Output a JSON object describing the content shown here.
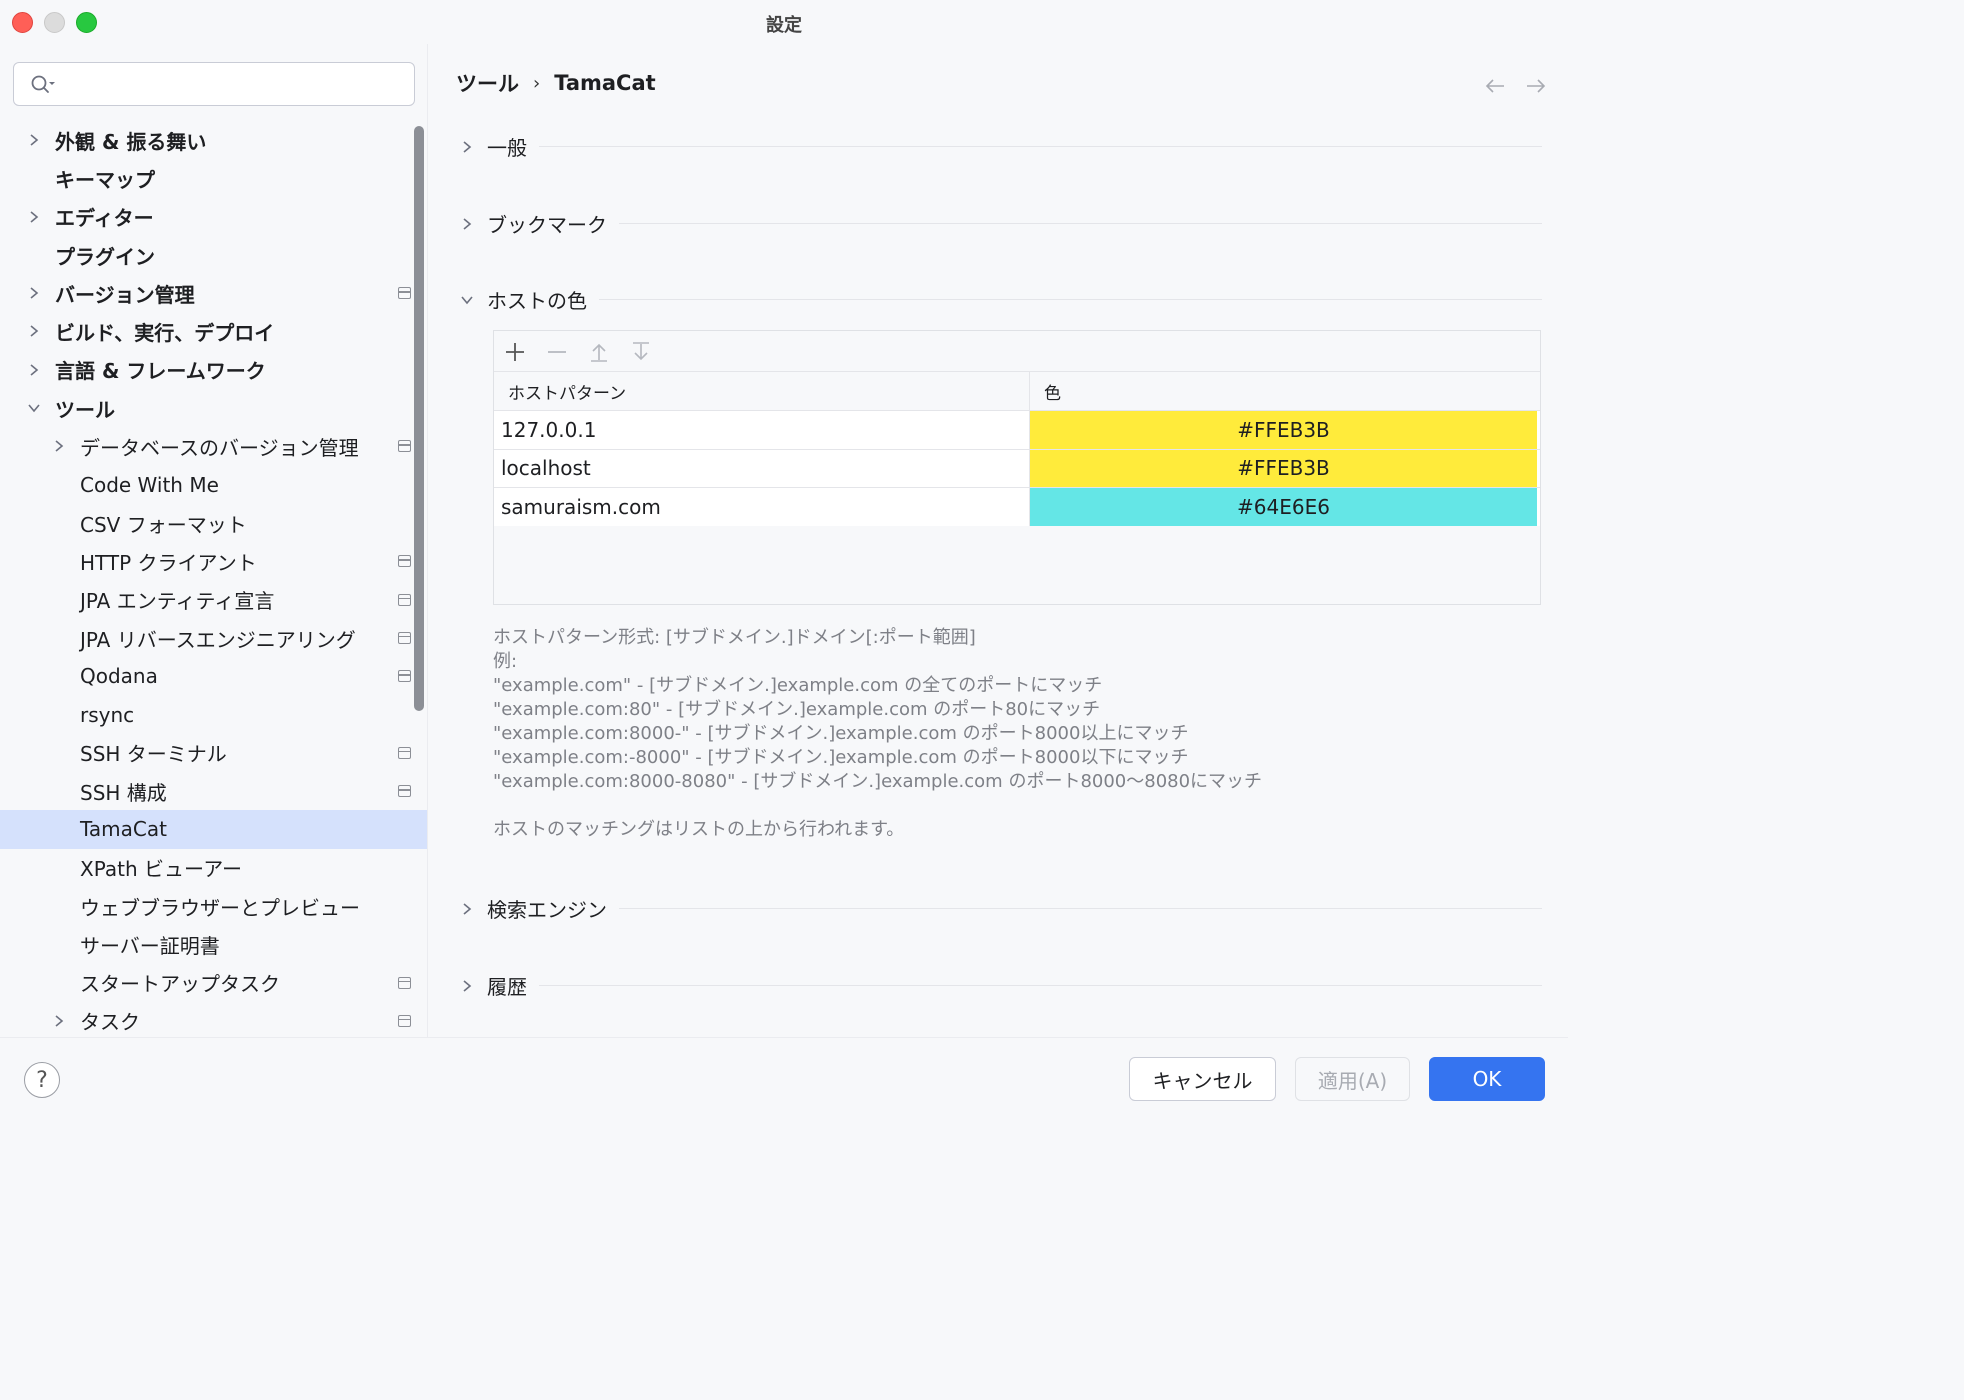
{
  "window": {
    "title": "設定"
  },
  "sidebar": {
    "search_placeholder": "",
    "items": [
      {
        "label": "外観 & 振る舞い",
        "level": 1,
        "expandable": true,
        "expanded": false,
        "project_icon": false
      },
      {
        "label": "キーマップ",
        "level": 1,
        "expandable": false,
        "project_icon": false
      },
      {
        "label": "エディター",
        "level": 1,
        "expandable": true,
        "expanded": false,
        "project_icon": false
      },
      {
        "label": "プラグイン",
        "level": 1,
        "expandable": false,
        "project_icon": false
      },
      {
        "label": "バージョン管理",
        "level": 1,
        "expandable": true,
        "expanded": false,
        "project_icon": true
      },
      {
        "label": "ビルド、実行、デプロイ",
        "level": 1,
        "expandable": true,
        "expanded": false,
        "project_icon": false
      },
      {
        "label": "言語 & フレームワーク",
        "level": 1,
        "expandable": true,
        "expanded": false,
        "project_icon": false
      },
      {
        "label": "ツール",
        "level": 1,
        "expandable": true,
        "expanded": true,
        "project_icon": false
      },
      {
        "label": "データベースのバージョン管理",
        "level": 2,
        "expandable": true,
        "expanded": false,
        "project_icon": true
      },
      {
        "label": "Code With Me",
        "level": 2,
        "expandable": false,
        "project_icon": false
      },
      {
        "label": "CSV フォーマット",
        "level": 2,
        "expandable": false,
        "project_icon": false
      },
      {
        "label": "HTTP クライアント",
        "level": 2,
        "expandable": false,
        "project_icon": true
      },
      {
        "label": "JPA エンティティ宣言",
        "level": 2,
        "expandable": false,
        "project_icon": true
      },
      {
        "label": "JPA リバースエンジニアリング",
        "level": 2,
        "expandable": false,
        "project_icon": true
      },
      {
        "label": "Qodana",
        "level": 2,
        "expandable": false,
        "project_icon": true
      },
      {
        "label": "rsync",
        "level": 2,
        "expandable": false,
        "project_icon": false
      },
      {
        "label": "SSH ターミナル",
        "level": 2,
        "expandable": false,
        "project_icon": true
      },
      {
        "label": "SSH 構成",
        "level": 2,
        "expandable": false,
        "project_icon": true
      },
      {
        "label": "TamaCat",
        "level": 2,
        "expandable": false,
        "project_icon": false,
        "selected": true
      },
      {
        "label": "XPath ビューアー",
        "level": 2,
        "expandable": false,
        "project_icon": false
      },
      {
        "label": "ウェブブラウザーとプレビュー",
        "level": 2,
        "expandable": false,
        "project_icon": false
      },
      {
        "label": "サーバー証明書",
        "level": 2,
        "expandable": false,
        "project_icon": false
      },
      {
        "label": "スタートアップタスク",
        "level": 2,
        "expandable": false,
        "project_icon": true
      },
      {
        "label": "タスク",
        "level": 2,
        "expandable": true,
        "expanded": false,
        "project_icon": true
      }
    ]
  },
  "breadcrumb": {
    "parent": "ツール",
    "separator": "›",
    "current": "TamaCat"
  },
  "sections": {
    "general": "一般",
    "bookmarks": "ブックマーク",
    "host_colors": "ホストの色",
    "search_engine": "検索エンジン",
    "history": "履歴"
  },
  "host_table": {
    "columns": [
      "ホストパターン",
      "色"
    ],
    "rows": [
      {
        "host": "127.0.0.1",
        "color": "#FFEB3B"
      },
      {
        "host": "localhost",
        "color": "#FFEB3B"
      },
      {
        "host": "samuraism.com",
        "color": "#64E6E6"
      }
    ]
  },
  "help_text": {
    "format": "ホストパターン形式: [サブドメイン.]ドメイン[:ポート範囲]",
    "examples_label": "例:",
    "examples": [
      "\"example.com\" - [サブドメイン.]example.com の全てのポートにマッチ",
      "\"example.com:80\" - [サブドメイン.]example.com のポート80にマッチ",
      "\"example.com:8000-\" - [サブドメイン.]example.com のポート8000以上にマッチ",
      "\"example.com:-8000\" - [サブドメイン.]example.com のポート8000以下にマッチ",
      "\"example.com:8000-8080\" - [サブドメイン.]example.com のポート8000〜8080にマッチ"
    ],
    "note": "ホストのマッチングはリストの上から行われます。"
  },
  "footer": {
    "help_label": "?",
    "cancel_label": "キャンセル",
    "apply_label": "適用(A)",
    "ok_label": "OK"
  },
  "colors": {
    "accent": "#3574f0",
    "selection": "#d5e1fc"
  }
}
